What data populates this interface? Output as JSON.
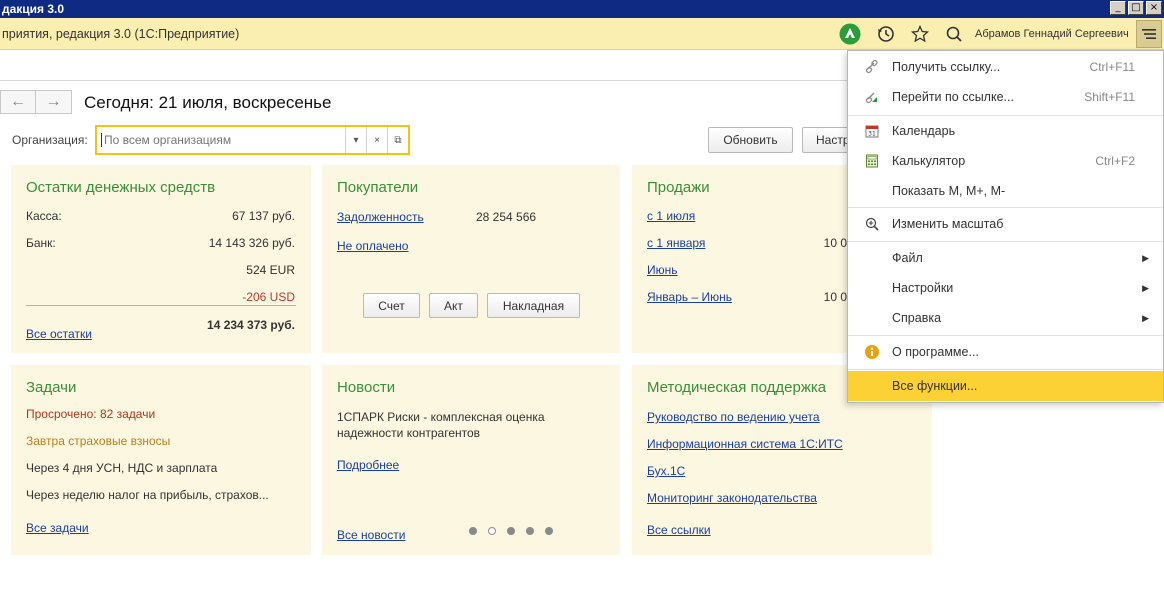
{
  "window": {
    "title": "дакция 3.0",
    "controls": [
      "_",
      "□",
      "×"
    ]
  },
  "header": {
    "app_title": "приятия, редакция 3.0  (1С:Предприятие)",
    "user": "Абрамов Геннадий Сергеевич"
  },
  "nav": {
    "back": "←",
    "forward": "→",
    "page_title": "Сегодня: 21 июля, воскресенье"
  },
  "org": {
    "label": "Организация:",
    "placeholder": "По всем организациям",
    "refresh": "Обновить",
    "settings": "Настр"
  },
  "cash": {
    "title": "Остатки денежных средств",
    "kassa_label": "Касса:",
    "kassa_value": "67 137 руб.",
    "bank_label": "Банк:",
    "bank_value": "14 143 326 руб.",
    "eur_value": "524 EUR",
    "usd_value": "-206 USD",
    "total": "14 234 373 руб.",
    "all_link": "Все остатки"
  },
  "buyers": {
    "title": "Покупатели",
    "debt_link": "Задолженность",
    "debt_value": "28 254 566",
    "unpaid_link": "Не оплачено",
    "buttons": [
      "Счет",
      "Акт",
      "Накладная"
    ]
  },
  "sales": {
    "title": "Продажи",
    "items": [
      {
        "label": "с 1 июля",
        "value": ""
      },
      {
        "label": "с 1 января",
        "value": "10 0"
      },
      {
        "label": "Июнь",
        "value": ""
      },
      {
        "label": "Январь – Июнь",
        "value": "10 0"
      }
    ]
  },
  "tasks": {
    "title": "Задачи",
    "overdue": "Просрочено: 82 задачи",
    "tomorrow": "Завтра страховые взносы",
    "in4days": "Через 4 дня УСН, НДС и зарплата",
    "inweek": "Через неделю налог на прибыль, страхов...",
    "all_link": "Все задачи"
  },
  "news": {
    "title": "Новости",
    "text_line1": "1СПАРК Риски - комплексная оценка",
    "text_line2": "надежности контрагентов",
    "more_link": "Подробнее",
    "all_link": "Все новости"
  },
  "support": {
    "title": "Методическая поддержка",
    "links": [
      "Руководство по ведению учета",
      "Информационная система 1С:ИТС",
      "Бух.1С",
      "Мониторинг законодательства"
    ],
    "all_link": "Все ссылки"
  },
  "menu": {
    "items": [
      {
        "label": "Получить ссылку...",
        "shortcut": "Ctrl+F11",
        "icon": "link-icon"
      },
      {
        "label": "Перейти по ссылке...",
        "shortcut": "Shift+F11",
        "icon": "goto-link-icon"
      },
      {
        "label": "Календарь",
        "shortcut": "",
        "icon": "calendar-icon"
      },
      {
        "label": "Калькулятор",
        "shortcut": "Ctrl+F2",
        "icon": "calculator-icon"
      },
      {
        "label": "Показать M, M+, M-",
        "shortcut": "",
        "icon": ""
      },
      {
        "label": "Изменить масштаб",
        "shortcut": "",
        "icon": "zoom-icon"
      },
      {
        "label": "Файл",
        "shortcut": "",
        "icon": ""
      },
      {
        "label": "Настройки",
        "shortcut": "",
        "icon": ""
      },
      {
        "label": "Справка",
        "shortcut": "",
        "icon": ""
      },
      {
        "label": "О программе...",
        "shortcut": "",
        "icon": "info-icon"
      },
      {
        "label": "Все функции...",
        "shortcut": "",
        "icon": ""
      }
    ]
  },
  "colors": {
    "accent": "#fbd136",
    "header_bg": "#fbeeb1",
    "panel_bg": "#fcf7e1",
    "title_green": "#3a8f3a",
    "link_blue": "#1a3f9c"
  }
}
